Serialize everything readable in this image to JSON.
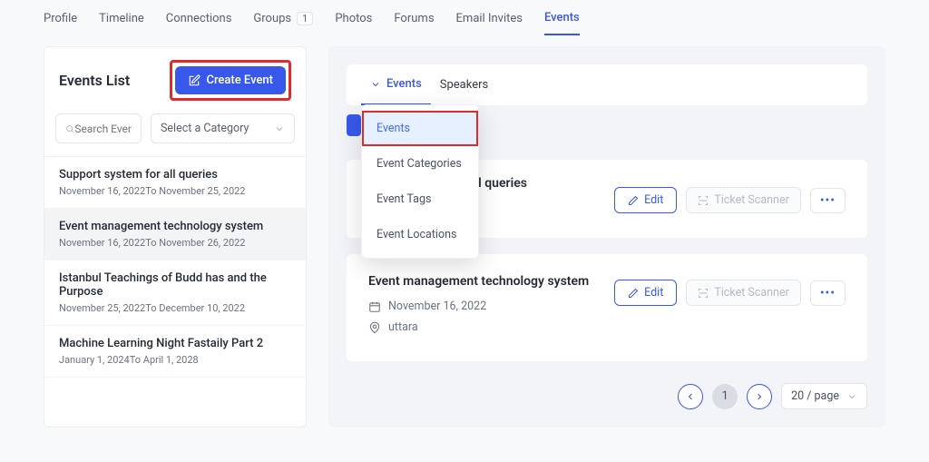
{
  "nav": {
    "items": [
      {
        "label": "Profile"
      },
      {
        "label": "Timeline"
      },
      {
        "label": "Connections"
      },
      {
        "label": "Groups",
        "badge": "1"
      },
      {
        "label": "Photos"
      },
      {
        "label": "Forums"
      },
      {
        "label": "Email Invites"
      },
      {
        "label": "Events",
        "active": true
      }
    ]
  },
  "sidebar": {
    "title": "Events List",
    "create_label": "Create Event",
    "search_placeholder": "Search Even",
    "category_placeholder": "Select a Category",
    "items": [
      {
        "title": "Support system for all queries",
        "dates": "November 16, 2022To November 25, 2022"
      },
      {
        "title": "Event management technology system",
        "dates": "November 16, 2022To November 26, 2022",
        "selected": true
      },
      {
        "title": "Istanbul Teachings of Budd has and the Purpose",
        "dates": "November 25, 2022To December 10, 2022"
      },
      {
        "title": "Machine Learning Night Fastaily Part 2",
        "dates": "January 1, 2024To April 1, 2028"
      }
    ]
  },
  "content": {
    "tabs": [
      {
        "label": "Events",
        "active": true
      },
      {
        "label": "Speakers"
      }
    ],
    "dropdown": [
      {
        "label": "Events",
        "active": true
      },
      {
        "label": "Event Categories"
      },
      {
        "label": "Event Tags"
      },
      {
        "label": "Event Locations"
      }
    ],
    "cards": [
      {
        "title_fragment": "all queries",
        "date": "",
        "edit": "Edit",
        "scanner": "Ticket Scanner"
      },
      {
        "title": "Event management technology system",
        "date": "November 16, 2022",
        "location": "uttara",
        "edit": "Edit",
        "scanner": "Ticket Scanner"
      }
    ],
    "pager": {
      "page": "1",
      "per_page": "20 / page"
    }
  }
}
